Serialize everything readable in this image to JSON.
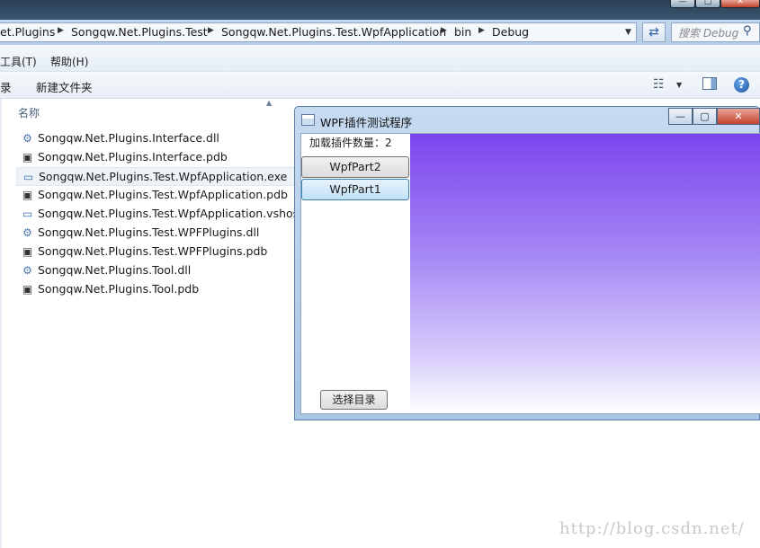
{
  "address_bar": {
    "breadcrumbs": [
      "et.Plugins",
      "Songqw.Net.Plugins.Test",
      "Songqw.Net.Plugins.Test.WpfApplication",
      "bin",
      "Debug"
    ],
    "search_placeholder": "搜索 Debug"
  },
  "menu": [
    "工具(T)",
    "帮助(H)"
  ],
  "toolbar": {
    "left_cut": "录",
    "new_folder": "新建文件夹"
  },
  "file_list": {
    "column_name": "名称",
    "files": [
      {
        "name": "Songqw.Net.Plugins.Interface.dll",
        "icon": "dll-icon"
      },
      {
        "name": "Songqw.Net.Plugins.Interface.pdb",
        "icon": "pdb-icon"
      },
      {
        "name": "Songqw.Net.Plugins.Test.WpfApplication.exe",
        "icon": "exe-icon"
      },
      {
        "name": "Songqw.Net.Plugins.Test.WpfApplication.pdb",
        "icon": "pdb-icon"
      },
      {
        "name": "Songqw.Net.Plugins.Test.WpfApplication.vshost.e",
        "icon": "exe-icon"
      },
      {
        "name": "Songqw.Net.Plugins.Test.WPFPlugins.dll",
        "icon": "dll-icon"
      },
      {
        "name": "Songqw.Net.Plugins.Test.WPFPlugins.pdb",
        "icon": "pdb-icon"
      },
      {
        "name": "Songqw.Net.Plugins.Tool.dll",
        "icon": "dll-icon"
      },
      {
        "name": "Songqw.Net.Plugins.Tool.pdb",
        "icon": "pdb-icon"
      }
    ]
  },
  "wpf_window": {
    "title": "WPF插件测试程序",
    "plugin_count": "加载插件数量：2",
    "plugins": [
      "WpfPart2",
      "WpfPart1"
    ],
    "choose_dir": "选择目录",
    "canvas_colors": [
      "#7c45ee",
      "#ffffff"
    ]
  },
  "watermark": "http://blog.csdn.net/"
}
